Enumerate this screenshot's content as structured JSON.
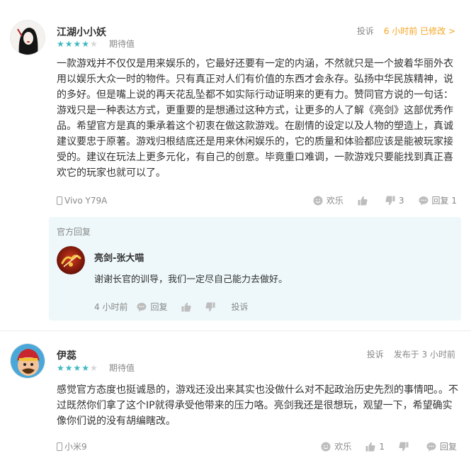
{
  "reviews": [
    {
      "username": "江湖小小妖",
      "rating": 4,
      "rating_label": "期待值",
      "report_label": "投诉",
      "time_label": "6 小时前 已修改 >",
      "content": "一款游戏并不仅仅是用来娱乐的，它最好还要有一定的内涵，不然就只是一个披着华丽外衣用以娱乐大众一时的物件。只有真正对人们有价值的东西才会永存。弘扬中华民族精神，说的多好。但是嘴上说的再天花乱坠都不如实际行动证明来的更有力。赞同官方说的一句话：游戏只是一种表达方式，更重要的是想通过这种方式，让更多的人了解《亮剑》这部优秀作品。希望官方是真的秉承着这个初衷在做这款游戏。在剧情的设定以及人物的塑造上，真诚建议要忠于原著。游戏归根结底还是用来休闲娱乐的，它的质量和体验都应该是能被玩家接受的。建议在玩法上更多元化，有自己的创意。毕竟重口难调，一款游戏只要能找到真正喜欢它的玩家也就可以了。",
      "device": "Vivo Y79A",
      "funny_label": "欢乐",
      "likes": "",
      "dislikes": "3",
      "reply_label": "回复 1",
      "official_reply": {
        "title": "官方回复",
        "name": "亮剑-张大喵",
        "content": "谢谢长官的训导，我们一定尽自己能力去做好。",
        "time": "4 小时前",
        "reply_label": "回复",
        "report_label": "投诉"
      }
    },
    {
      "username": "伊蕊",
      "rating": 4,
      "rating_label": "期待值",
      "report_label": "投诉",
      "time_label": "发布于 3 小时前",
      "content": "感觉官方态度也挺诚恳的，游戏还没出来其实也没做什么对不起政治历史先烈的事情吧。。不过既然你们拿了这个IP就得承受他带来的压力咯。亮剑我还是很想玩，观望一下，希望确实像你们说的没有胡编瞎改。",
      "device": "小米9",
      "funny_label": "欢乐",
      "likes": "1",
      "dislikes": "",
      "reply_label": "回复"
    }
  ],
  "colors": {
    "star": "#3fb8c0",
    "edited_time": "#f5a623",
    "official_bg": "#eef8fa"
  },
  "icons": [
    "phone-icon",
    "smile-icon",
    "thumb-up-icon",
    "thumb-down-icon",
    "comment-icon"
  ]
}
